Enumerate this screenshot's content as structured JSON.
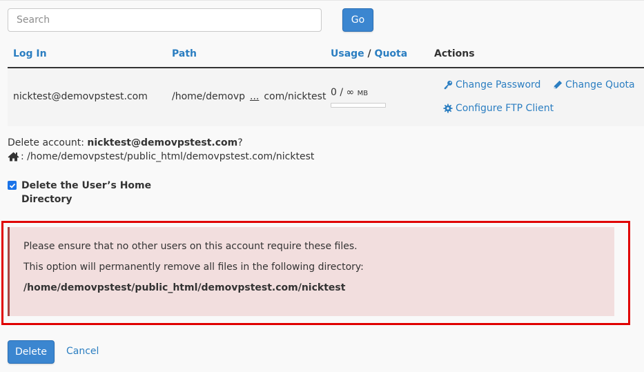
{
  "search": {
    "placeholder": "Search",
    "button_label": "Go"
  },
  "table": {
    "headers": {
      "login": "Log In",
      "path": "Path",
      "usage": "Usage",
      "separator": " / ",
      "quota": "Quota",
      "actions": "Actions"
    },
    "row": {
      "login": "nicktest@demovpstest.com",
      "path_start": "/home/demovp",
      "path_ellipsis": "...",
      "path_end": "com/nicktest",
      "usage_value": "0 / ∞",
      "usage_unit": "MB",
      "usage_fraction": 0
    },
    "actions": {
      "change_password": "Change Password",
      "change_quota": "Change Quota",
      "configure_ftp": "Configure FTP Client"
    }
  },
  "delete_info": {
    "prefix": "Delete account: ",
    "account": "nicktest@demovpstest.com",
    "suffix": "?",
    "home_path": ": /home/demovpstest/public_html/demovpstest.com/nicktest"
  },
  "checkbox": {
    "label": "Delete the User’s Home Directory",
    "checked": true
  },
  "warning": {
    "line1": "Please ensure that no other users on this account require these files.",
    "line2": "This option will permanently remove all files in the following directory:",
    "path": "/home/demovpstest/public_html/demovpstest.com/nicktest"
  },
  "buttons": {
    "delete": "Delete",
    "cancel": "Cancel"
  },
  "colors": {
    "primary": "#3b86d0",
    "link": "#2b7ec1",
    "warning_bg": "#f2dede",
    "highlight": "#e00000"
  }
}
